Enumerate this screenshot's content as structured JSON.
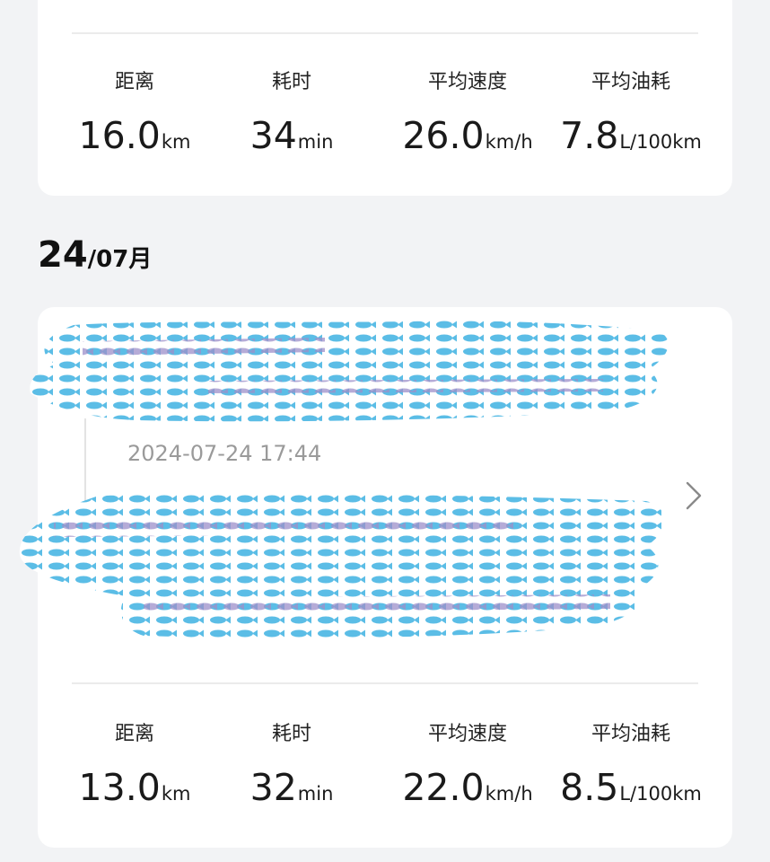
{
  "top_card": {
    "stats": [
      {
        "label": "距离",
        "value": "16.0",
        "unit": "km"
      },
      {
        "label": "耗时",
        "value": "34",
        "unit": "min"
      },
      {
        "label": "平均速度",
        "value": "26.0",
        "unit": "km/h"
      },
      {
        "label": "平均油耗",
        "value": "7.8",
        "unit": "L/100km"
      }
    ]
  },
  "date_header": {
    "day": "24",
    "month": "/07月"
  },
  "trip_card": {
    "timestamp": "2024-07-24 17:44",
    "stats": [
      {
        "label": "距离",
        "value": "13.0",
        "unit": "km"
      },
      {
        "label": "耗时",
        "value": "32",
        "unit": "min"
      },
      {
        "label": "平均速度",
        "value": "22.0",
        "unit": "km/h"
      },
      {
        "label": "平均油耗",
        "value": "8.5",
        "unit": "L/100km"
      }
    ]
  },
  "colors": {
    "background": "#f2f3f5",
    "card": "#ffffff",
    "censor_blue": "#5bbde6",
    "censor_purple": "#9c8fc9"
  },
  "icons": {
    "trip_chevron": "chevron-right-icon"
  }
}
